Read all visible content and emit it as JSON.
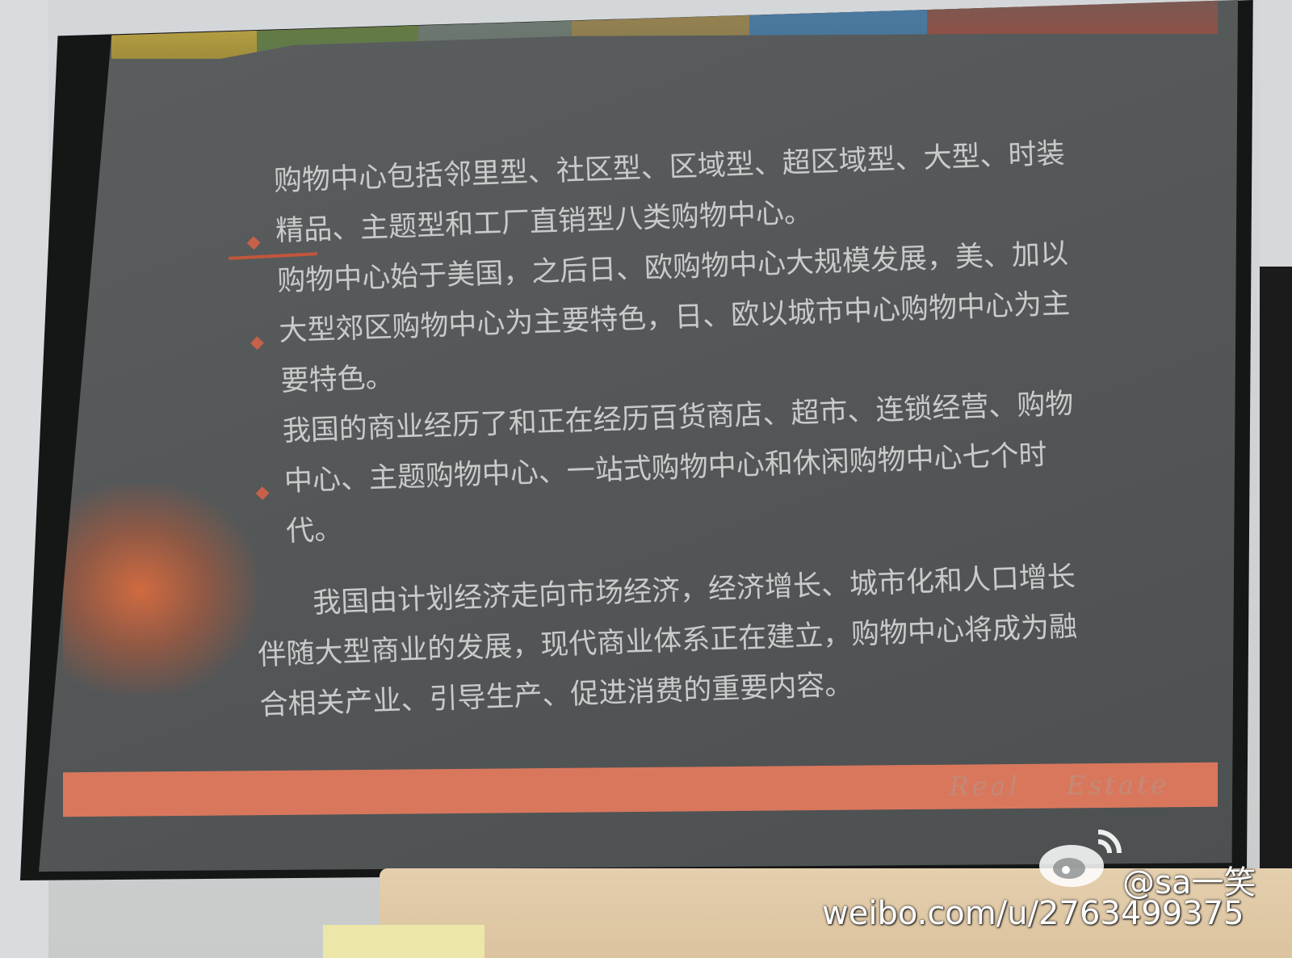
{
  "slide": {
    "bullets": [
      "购物中心包括邻里型、社区型、区域型、超区域型、大型、时装精品、主题型和工厂直销型八类购物中心。",
      "购物中心始于美国，之后日、欧购物中心大规模发展，美、加以大型郊区购物中心为主要特色，日、欧以城市中心购物中心为主要特色。",
      "我国的商业经历了和正在经历百货商店、超市、连锁经营、购物中心、主题购物中心、一站式购物中心和休闲购物中心七个时代。"
    ],
    "closing_paragraph": "我国由计划经济走向市场经济，经济增长、城市化和人口增长伴随大型商业的发展，现代商业体系正在建立，购物中心将成为融合相关产业、引导生产、促进消费的重要内容。",
    "footer_text": "Real    Estate"
  },
  "watermark": {
    "handle": "@sa一笑",
    "url": "weibo.com/u/2763499375"
  },
  "colors": {
    "screen": "#555859",
    "slide_text": "#c9cbcb",
    "accent_red": "#d9775d",
    "bullet": "#c76149"
  }
}
